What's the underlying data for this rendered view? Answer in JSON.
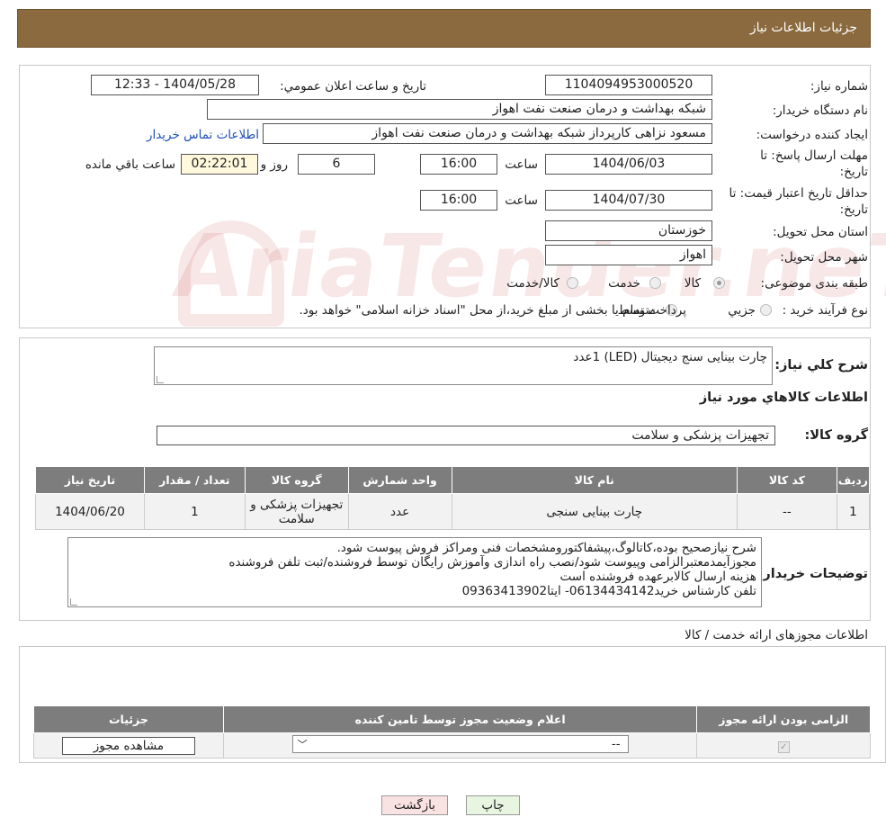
{
  "header": {
    "title": "جزئیات اطلاعات نیاز"
  },
  "watermark": {
    "text": "AriaTender.neT"
  },
  "info": {
    "need_number_label": "شماره نیاز:",
    "need_number": "1104094953000520",
    "announce_label": "تاریخ و ساعت اعلان عمومي:",
    "announce_value": "1404/05/28 - 12:33",
    "buyer_org_label": "نام دستگاه خريدار:",
    "buyer_org": "شبکه بهداشت و درمان صنعت نفت اهواز",
    "creator_label": "ايجاد کننده درخواست:",
    "creator": "مسعود نزاهی کارپرداز شبکه بهداشت و درمان صنعت نفت اهواز",
    "contact_link": "اطلاعات تماس خريدار",
    "deadline_label_1": "مهلت ارسال پاسخ: تا",
    "deadline_label_2": "تاريخ:",
    "deadline_date": "1404/06/03",
    "time_label": "ساعت",
    "deadline_time": "16:00",
    "days": "6",
    "days_label": "روز و",
    "remaining": "02:22:01",
    "remaining_label": "ساعت باقي مانده",
    "validity_label_1": "حداقل تاريخ اعتبار قيمت: تا",
    "validity_label_2": "تاريخ:",
    "validity_date": "1404/07/30",
    "validity_time": "16:00",
    "province_label": "استان محل تحويل:",
    "province": "خوزستان",
    "city_label": "شهر محل تحويل:",
    "city": "اهواز",
    "category_label": "طبقه بندی موضوعی:",
    "category_options": [
      "کالا",
      "خدمت",
      "کالا/خدمت"
    ],
    "process_label": "نوع فرآيند خريد :",
    "process_options": [
      "جزيي",
      "متوسط"
    ],
    "process_note": "پرداخت تمام يا بخشی از مبلغ خريد،از محل \"اسناد خزانه اسلامی\" خواهد بود."
  },
  "summary": {
    "label": "شرح کلي نياز:",
    "value": "چارت بینایی سنج دیجیتال (LED)    1عدد",
    "goods_info_title": "اطلاعات کالاهاي مورد نياز",
    "group_label": "گروه کالا:",
    "group_value": "تجهیزات پزشکی و سلامت"
  },
  "goods_table": {
    "headers": [
      "رديف",
      "کد کالا",
      "نام کالا",
      "واحد شمارش",
      "گروه کالا",
      "تعداد / مقدار",
      "تاريخ نياز"
    ],
    "rows": [
      [
        "1",
        "--",
        "چارت بینایی سنجی",
        "عدد",
        "تجهیزات پزشکی و سلامت",
        "1",
        "1404/06/20"
      ]
    ]
  },
  "buyer_notes": {
    "label": "توضيحات خريدار:",
    "lines": [
      "شرح نیازصحیح بوده،کاتالوگ،پیشفاکتورومشخصات فنی ومراکز فروش پیوست شود.",
      "مجوزآیمدمعتبرالزامی وپیوست شود/نصب راه اندازی وآموزش رایگان توسط فروشنده/ثبت تلفن فروشنده",
      "هزینه ارسال کالابرعهده فروشنده است",
      "تلفن کارشناس خرید06134434142- ایتا09363413902"
    ]
  },
  "permits": {
    "title": "اطلاعات مجوزهای ارائه خدمت / کالا",
    "headers": [
      "الزامی بودن ارائه مجوز",
      "اعلام وضعيت مجوز توسط تامين کننده",
      "جزئيات"
    ],
    "select_value": "--",
    "view_button": "مشاهده مجوز"
  },
  "footer": {
    "print_button": "چاپ",
    "back_button": "بازگشت"
  }
}
